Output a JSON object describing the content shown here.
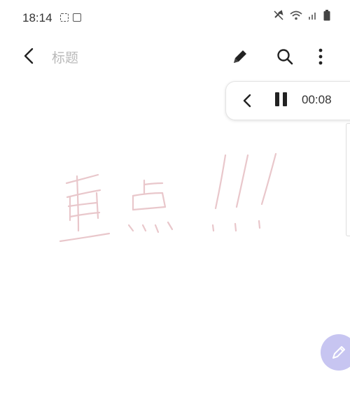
{
  "status_bar": {
    "time": "18:14"
  },
  "toolbar": {
    "title_placeholder": "标题"
  },
  "playback": {
    "time": "00:08"
  },
  "colors": {
    "handwriting": "#e9c7cb",
    "fab": "#c7c5f1",
    "icon": "#222222"
  },
  "icons": {
    "back": "chevron-left-icon",
    "pen": "pen-icon",
    "search": "search-icon",
    "more": "more-vert-icon",
    "pause": "pause-icon",
    "fab_pen": "pen-icon"
  }
}
